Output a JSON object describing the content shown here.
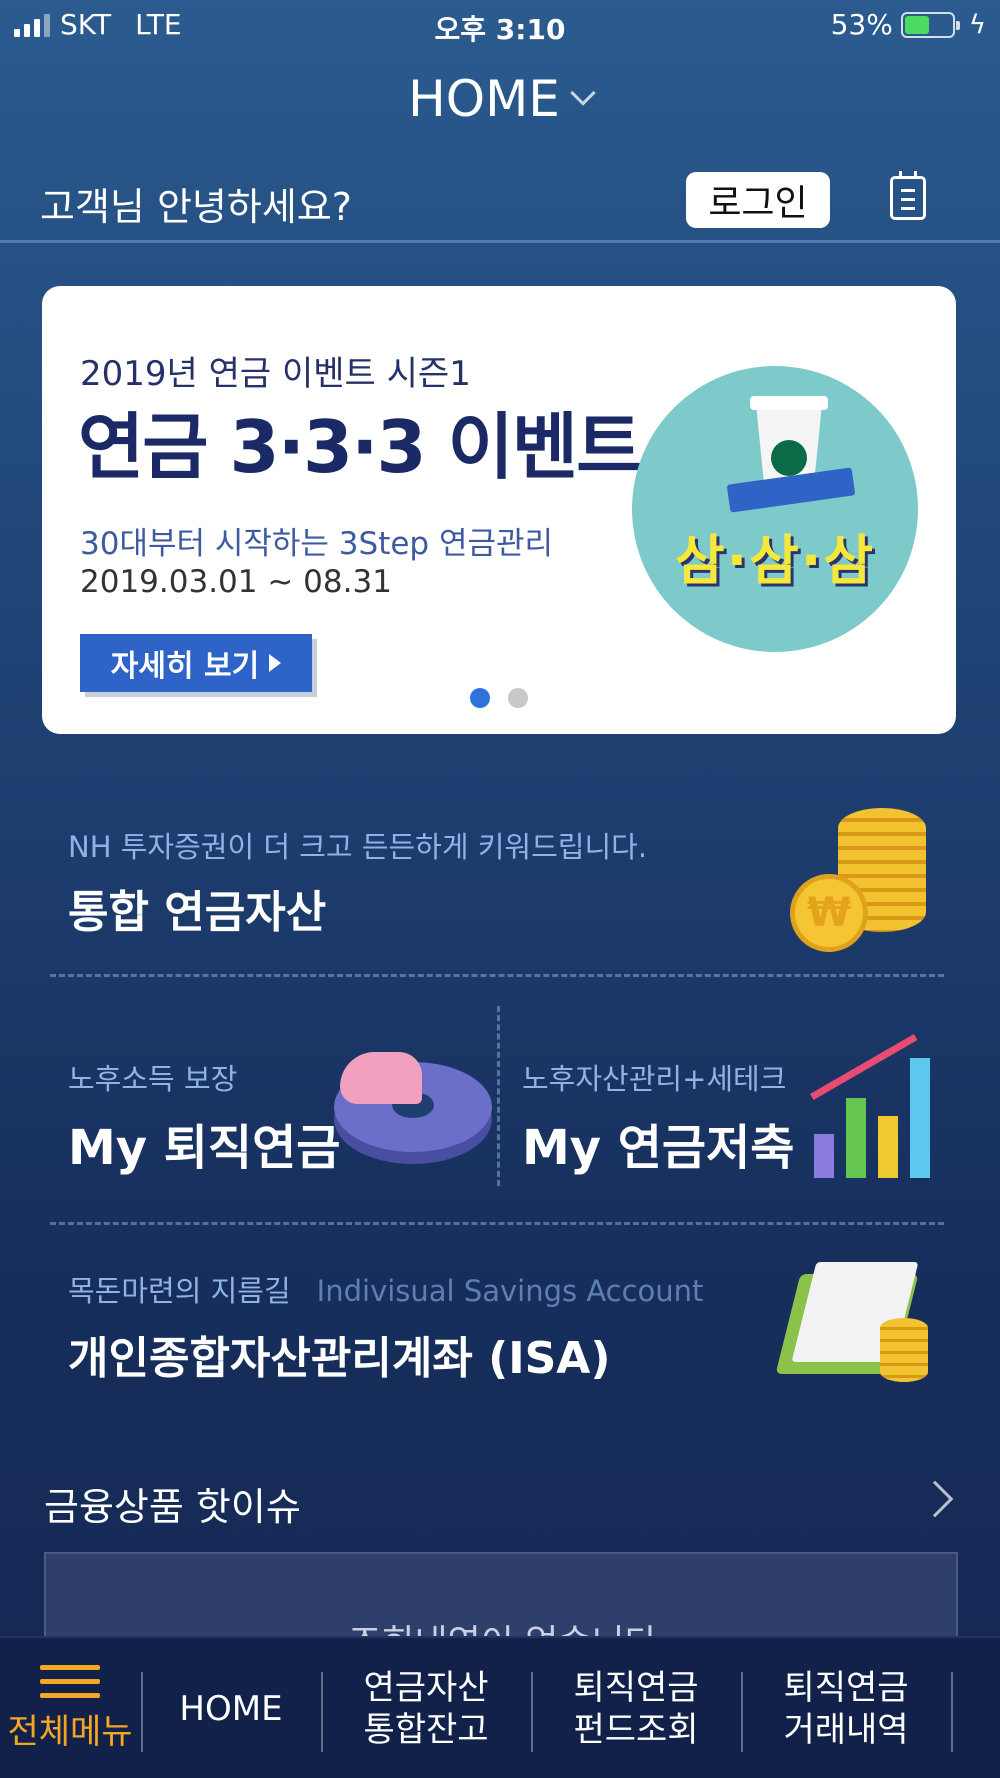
{
  "status_bar": {
    "carrier": "SKT",
    "network": "LTE",
    "time": "오후 3:10",
    "battery": "53%",
    "battery_level": 0.53
  },
  "header": {
    "title": "HOME",
    "greeting": "고객님 안녕하세요?",
    "login_label": "로그인"
  },
  "event_banner": {
    "season": "2019년 연금 이벤트 시즌1",
    "title": "연금 3·3·3 이벤트",
    "subtitle": "30대부터 시작하는 3Step 연금관리",
    "period": "2019.03.01 ~ 08.31",
    "detail_button": "자세히 보기",
    "illustration_text": "삼·삼·삼",
    "slide_count": 2,
    "active_slide": 1
  },
  "menu": {
    "pension": {
      "sub": "NH 투자증권이 더 크고 든든하게 키워드립니다.",
      "title": "통합 연금자산"
    },
    "retirement": {
      "sub": "노후소득 보장",
      "title": "My 퇴직연금"
    },
    "savings": {
      "sub": "노후자산관리+세테크",
      "title": "My 연금저축"
    },
    "isa": {
      "sub": "목돈마련의 지름길",
      "sub_en": "Indivisual Savings Account",
      "title": "개인종합자산관리계좌 (ISA)"
    }
  },
  "hot_issue": {
    "title": "금융상품 핫이슈",
    "empty_message": "조회내역이 없습니다"
  },
  "bottom_nav": {
    "all_menu": "전체메뉴",
    "home": "HOME",
    "asset_line1": "연금자산",
    "asset_line2": "통합잔고",
    "fund_line1": "퇴직연금",
    "fund_line2": "펀드조회",
    "tx_line1": "퇴직연금",
    "tx_line2": "거래내역"
  },
  "colors": {
    "accent_orange": "#f5a623",
    "button_blue": "#2e63c8",
    "dot_active": "#2e73d9"
  }
}
